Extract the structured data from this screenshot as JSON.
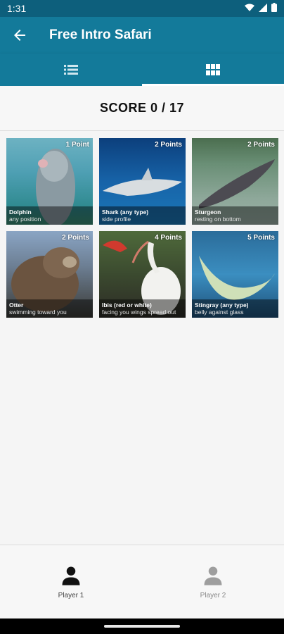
{
  "status": {
    "time": "1:31"
  },
  "app_bar": {
    "title": "Free Intro Safari"
  },
  "tabs": [
    {
      "icon": "list-icon"
    },
    {
      "icon": "grid-icon"
    }
  ],
  "score": {
    "text": "SCORE 0 / 17"
  },
  "cards": [
    {
      "points": "1 Point",
      "name": "Dolphin",
      "desc": "any position"
    },
    {
      "points": "2 Points",
      "name": "Shark (any type)",
      "desc": "side profile"
    },
    {
      "points": "2 Points",
      "name": "Sturgeon",
      "desc": "resting on bottom"
    },
    {
      "points": "2 Points",
      "name": "Otter",
      "desc": "swimming toward you"
    },
    {
      "points": "4 Points",
      "name": "Ibis (red or white)",
      "desc": "facing you wings spread out"
    },
    {
      "points": "5 Points",
      "name": "Stingray (any type)",
      "desc": "belly against glass"
    }
  ],
  "bottom_nav": [
    {
      "label": "Player 1",
      "active": true
    },
    {
      "label": "Player 2",
      "active": false
    }
  ],
  "colors": {
    "app_bar": "#137a9a",
    "status_bar": "#0d5f7c",
    "active_icon": "#111111",
    "inactive_icon": "#9e9e9e"
  }
}
